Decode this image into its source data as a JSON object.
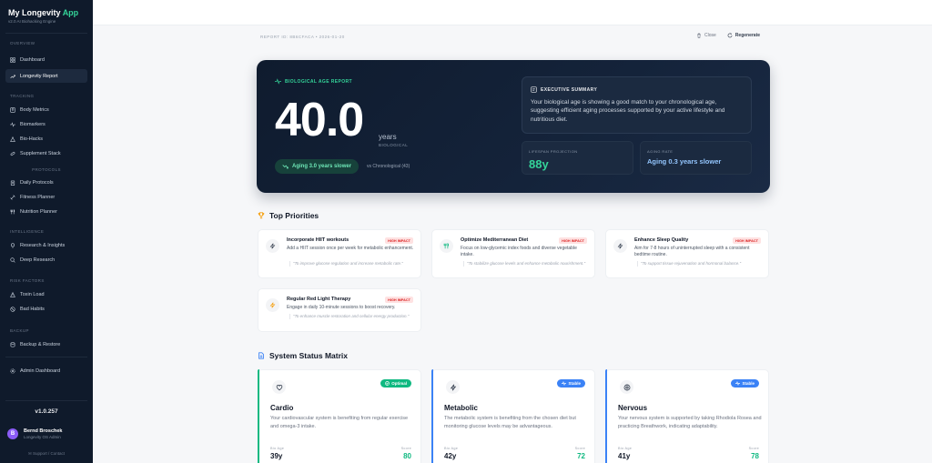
{
  "sidebar": {
    "app_title": "My Longevity",
    "app_title_accent": "App",
    "app_subtitle": "v2.0 AI Biohacking Engine",
    "sections": {
      "overview": "Overview",
      "tracking": "Tracking",
      "protocols": "Protocols",
      "intelligence": "Intelligence",
      "risk_factors": "Risk Factors",
      "backup": "Backup"
    },
    "items": {
      "dashboard": "Dashboard",
      "longevity_report": "Longevity Report",
      "body_metrics": "Body Metrics",
      "biomarkers": "Biomarkers",
      "bio_hacks": "Bio-Hacks",
      "supplement_stack": "Supplement Stack",
      "daily_protocols": "Daily Protocols",
      "fitness_planner": "Fitness Planner",
      "nutrition_planner": "Nutrition Planner",
      "research_insights": "Research & Insights",
      "deep_research": "Deep Research",
      "toxin_load": "Toxin Load",
      "bad_habits": "Bad Habits",
      "backup_restore": "Backup & Restore",
      "admin_dashboard": "Admin Dashboard"
    },
    "version": "v1.0.257",
    "user": {
      "initial": "B",
      "name": "Bernd Broschek",
      "role": "Longevity OS Admin"
    },
    "support": "Support / Contact"
  },
  "header": {
    "report_id": "Report ID: 8B6CFACA • 2026-01-20",
    "close_label": "Close",
    "regenerate_label": "Regenerate"
  },
  "hero": {
    "tag": "Biological Age Report",
    "age": "40.0",
    "unit": "years",
    "unit_sub": "Biological",
    "aging_pill": "Aging 3.0 years slower",
    "vs_chrono": "vs Chronological (43)",
    "exec_title": "Executive Summary",
    "exec_text": "Your biological age is showing a good match to your chronological age, suggesting efficient aging processes supported by your active lifestyle and nutritious diet.",
    "lifespan_label": "Lifespan Projection",
    "lifespan_value": "88y",
    "rate_label": "Aging Rate",
    "rate_value": "Aging 0.3 years slower"
  },
  "priorities": {
    "title": "Top Priorities",
    "items": [
      {
        "title": "Incorporate HIIT workouts",
        "badge": "High Impact",
        "desc": "Add a HIIT session once per week for metabolic enhancement.",
        "quote": "\"To improve glucose regulation and increase metabolic rate.\""
      },
      {
        "title": "Optimize Mediterranean Diet",
        "badge": "High Impact",
        "desc": "Focus on low-glycemic index foods and diverse vegetable intake.",
        "quote": "\"To stabilize glucose levels and enhance metabolic nourishment.\""
      },
      {
        "title": "Enhance Sleep Quality",
        "badge": "High Impact",
        "desc": "Aim for 7-8 hours of uninterrupted sleep with a consistent bedtime routine.",
        "quote": "\"To support tissue rejuvenation and hormonal balance.\""
      },
      {
        "title": "Regular Red Light Therapy",
        "badge": "High Impact",
        "desc": "Engage in daily 10-minute sessions to boost recovery.",
        "quote": "\"To enhance muscle restoration and cellular energy production.\""
      }
    ]
  },
  "systems": {
    "title": "System Status Matrix",
    "bio_age_label": "Bio Age",
    "score_label": "Score",
    "items": [
      {
        "name": "Cardio",
        "badge": "Optimal",
        "desc": "Your cardiovascular system is benefiting from regular exercise and omega-3 intake.",
        "bio_age": "39y",
        "score": "80",
        "color": "#10b981"
      },
      {
        "name": "Metabolic",
        "badge": "Stable",
        "desc": "The metabolic system is benefiting from the chosen diet but monitoring glucose levels may be advantageous.",
        "bio_age": "42y",
        "score": "72",
        "color": "#3b82f6"
      },
      {
        "name": "Nervous",
        "badge": "Stable",
        "desc": "Your nervous system is supported by taking Rhodiola Rosea and practicing Breathwork, indicating adaptability.",
        "bio_age": "41y",
        "score": "78",
        "color": "#3b82f6"
      }
    ]
  },
  "colors": {
    "sidebar_bg": "#0f1a2b",
    "accent_green": "#34d399",
    "stable_blue": "#3b82f6",
    "high_impact_red": "#dc2626"
  }
}
